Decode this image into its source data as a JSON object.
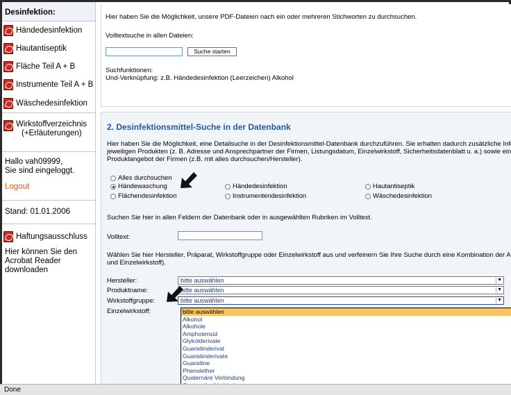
{
  "sidebar": {
    "title": "Desinfektion:",
    "items": [
      {
        "label": "Händedesinfektion",
        "icon": "pdf-icon"
      },
      {
        "label": "Hautantiseptik",
        "icon": "pdf-icon"
      },
      {
        "label": "Fläche Teil A + B",
        "icon": "pdf-icon"
      },
      {
        "label": "Instrumente Teil A + B",
        "icon": "pdf-icon"
      },
      {
        "label": "Wäschedesinfektion",
        "icon": "pdf-icon"
      }
    ],
    "wirkstoff_label_1": "Wirkstoffverzeichnis",
    "wirkstoff_label_2": "(+Erläuterungen)",
    "login_line1": "Hallo vah09999,",
    "login_line2": "Sie sind eingeloggt.",
    "logout": "Logout",
    "stand": "Stand: 01.01.2006",
    "haftung": "Haftungsausschluss",
    "acrobat_1": "Hier können Sie den",
    "acrobat_2": "Acrobat Reader",
    "acrobat_3": "downloaden"
  },
  "box1": {
    "intro": "Hier haben Sie die Möglichkeit, unsere PDF-Dateien nach ein oder mehreren Stichworten zu durchsuchen.",
    "search_label": "Volltextsuche in allen Dateien:",
    "search_value": "",
    "search_button": "Suche starten",
    "functions_title": "Suchfunktionen:",
    "functions_text": "Und-Verknüpfung: z.B. Händedesinfektion (Leerzeichen) Alkohol"
  },
  "box2": {
    "heading": "2. Desinfektionsmittel-Suche in der Datenbank",
    "intro_1": "Hier haben Sie die Möglichkeit, eine Detailsuche in der Desinfektionsmittel-Datenbank durchzuführen. Sie erhalten dadurch zusätzliche Inform",
    "intro_2": "jeweiligen Produkten (z. B. Adresse und Ansprechpartner der Firmen, Listungsdatum, Einzelwirkstoff, Sicherheitsdatenblatt u. a.) sowie einen",
    "intro_3": "Produktangebot der Firmen (z.B. mit alles durchsuchen/Hersteller).",
    "radios": [
      {
        "label": "Alles durchsuchen",
        "checked": false
      },
      {
        "label": "Händewaschung",
        "checked": true
      },
      {
        "label": "Händedesinfektion",
        "checked": false
      },
      {
        "label": "Hautantiseptik",
        "checked": false
      },
      {
        "label": "Flächendesinfektion",
        "checked": false
      },
      {
        "label": "Instrumentendesinfektion",
        "checked": false
      },
      {
        "label": "Wäschedesinfektion",
        "checked": false
      }
    ],
    "fields_text": "Suchen Sie hier in allen Feldern der Datenbank oder in ausgewählten Rubriken im Volltext.",
    "volltext_label": "Volltext:",
    "volltext_value": "",
    "combo_text_1": "Wählen Sie hier Hersteller, Präparat, Wirkstoffgruppe oder Einzelwirkstoff aus und verfeinern Sie Ihre Suche durch eine Kombination der Abfra",
    "combo_text_2": "und Einzelwirkstoff).",
    "hersteller_label": "Hersteller:",
    "hersteller_value": "bitte auswählen",
    "produktname_label": "Produktname:",
    "produktname_value": "bitte auswählen",
    "wirkstoffgruppe_label": "Wirkstoffgruppe:",
    "wirkstoffgruppe_value": "bitte auswählen",
    "einzelwirkstoff_label": "Einzelwirkstoff:",
    "dropdown_options": [
      "bitte auswählen",
      "Alkohol",
      "Alkohole",
      "Amphotensid",
      "Glykolderivate",
      "Guanidinderivat",
      "Guanidinderivate",
      "Guanidine",
      "Phenolether",
      "Quaternäre Verbindung",
      "Quaternäre Verbindungen"
    ]
  },
  "statusbar": {
    "text": "Done"
  },
  "colors": {
    "heading": "#1f58b4",
    "logout": "#e05a12",
    "highlight": "#f6c464"
  }
}
